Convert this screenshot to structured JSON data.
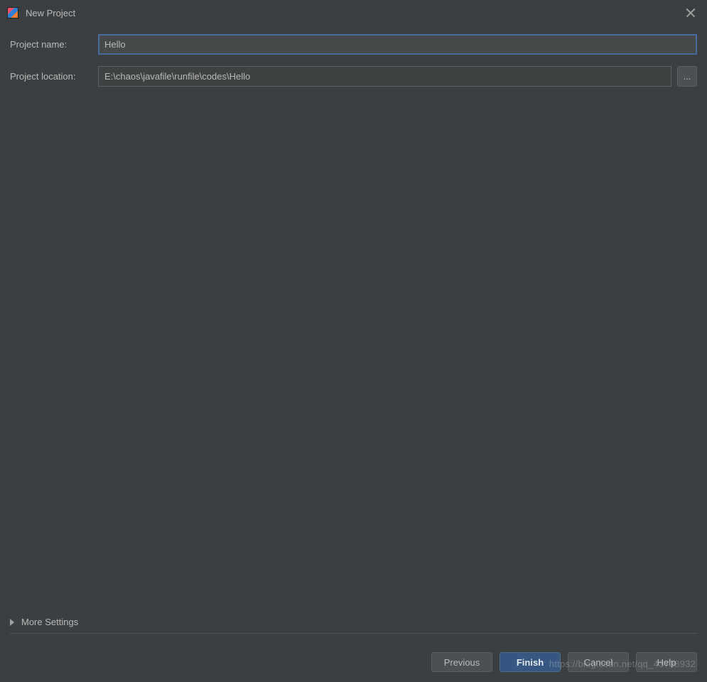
{
  "window": {
    "title": "New Project"
  },
  "form": {
    "project_name_label": "Project name:",
    "project_name_value": "Hello",
    "project_location_label": "Project location:",
    "project_location_value": "E:\\chaos\\javafile\\runfile\\codes\\Hello",
    "browse_label": "..."
  },
  "more_settings": {
    "label": "More Settings"
  },
  "buttons": {
    "previous": "Previous",
    "finish": "Finish",
    "cancel": "Cancel",
    "help": "Help"
  },
  "watermark": "https://blog.csdn.net/qq_43738932"
}
